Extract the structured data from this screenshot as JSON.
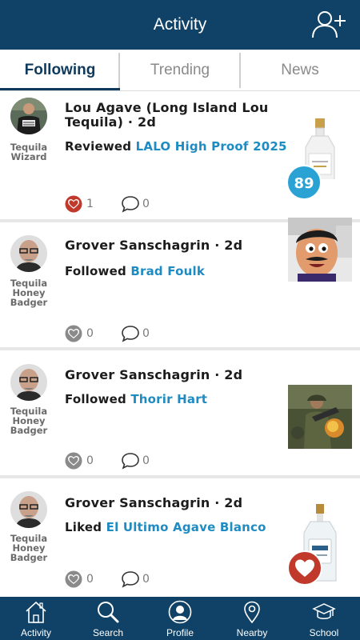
{
  "header": {
    "title": "Activity",
    "add_friend_icon": "add-user-icon"
  },
  "tabs": [
    {
      "label": "Following",
      "active": true
    },
    {
      "label": "Trending",
      "active": false
    },
    {
      "label": "News",
      "active": false
    }
  ],
  "feed": [
    {
      "user_label": "Tequila Wizard",
      "title": "Lou  Agave (Long Island Lou Tequila) · 2d",
      "action_verb": "Reviewed",
      "action_target": "LALO High Proof 2025",
      "likes": "1",
      "comments": "0",
      "liked": true,
      "score": "89"
    },
    {
      "user_label": "Tequila Honey Badger",
      "title": "Grover Sanschagrin · 2d",
      "action_verb": "Followed",
      "action_target": "Brad Foulk",
      "likes": "0",
      "comments": "0",
      "liked": false
    },
    {
      "user_label": "Tequila Honey Badger",
      "title": "Grover Sanschagrin · 2d",
      "action_verb": "Followed",
      "action_target": "Thorir Hart",
      "likes": "0",
      "comments": "0",
      "liked": false
    },
    {
      "user_label": "Tequila Honey Badger",
      "title": "Grover Sanschagrin · 2d",
      "action_verb": "Liked",
      "action_target": "El Ultimo Agave Blanco",
      "likes": "0",
      "comments": "0",
      "liked": false,
      "badge_icon": "heart-icon"
    }
  ],
  "navbar": [
    {
      "label": "Activity",
      "icon": "home-icon"
    },
    {
      "label": "Search",
      "icon": "search-icon"
    },
    {
      "label": "Profile",
      "icon": "profile-icon"
    },
    {
      "label": "Nearby",
      "icon": "location-pin-icon"
    },
    {
      "label": "School",
      "icon": "graduation-cap-icon"
    }
  ],
  "colors": {
    "header_bg": "#0f4266",
    "link": "#1e8bc3",
    "score_badge": "#2aa3d4",
    "like_red": "#c0392b"
  }
}
